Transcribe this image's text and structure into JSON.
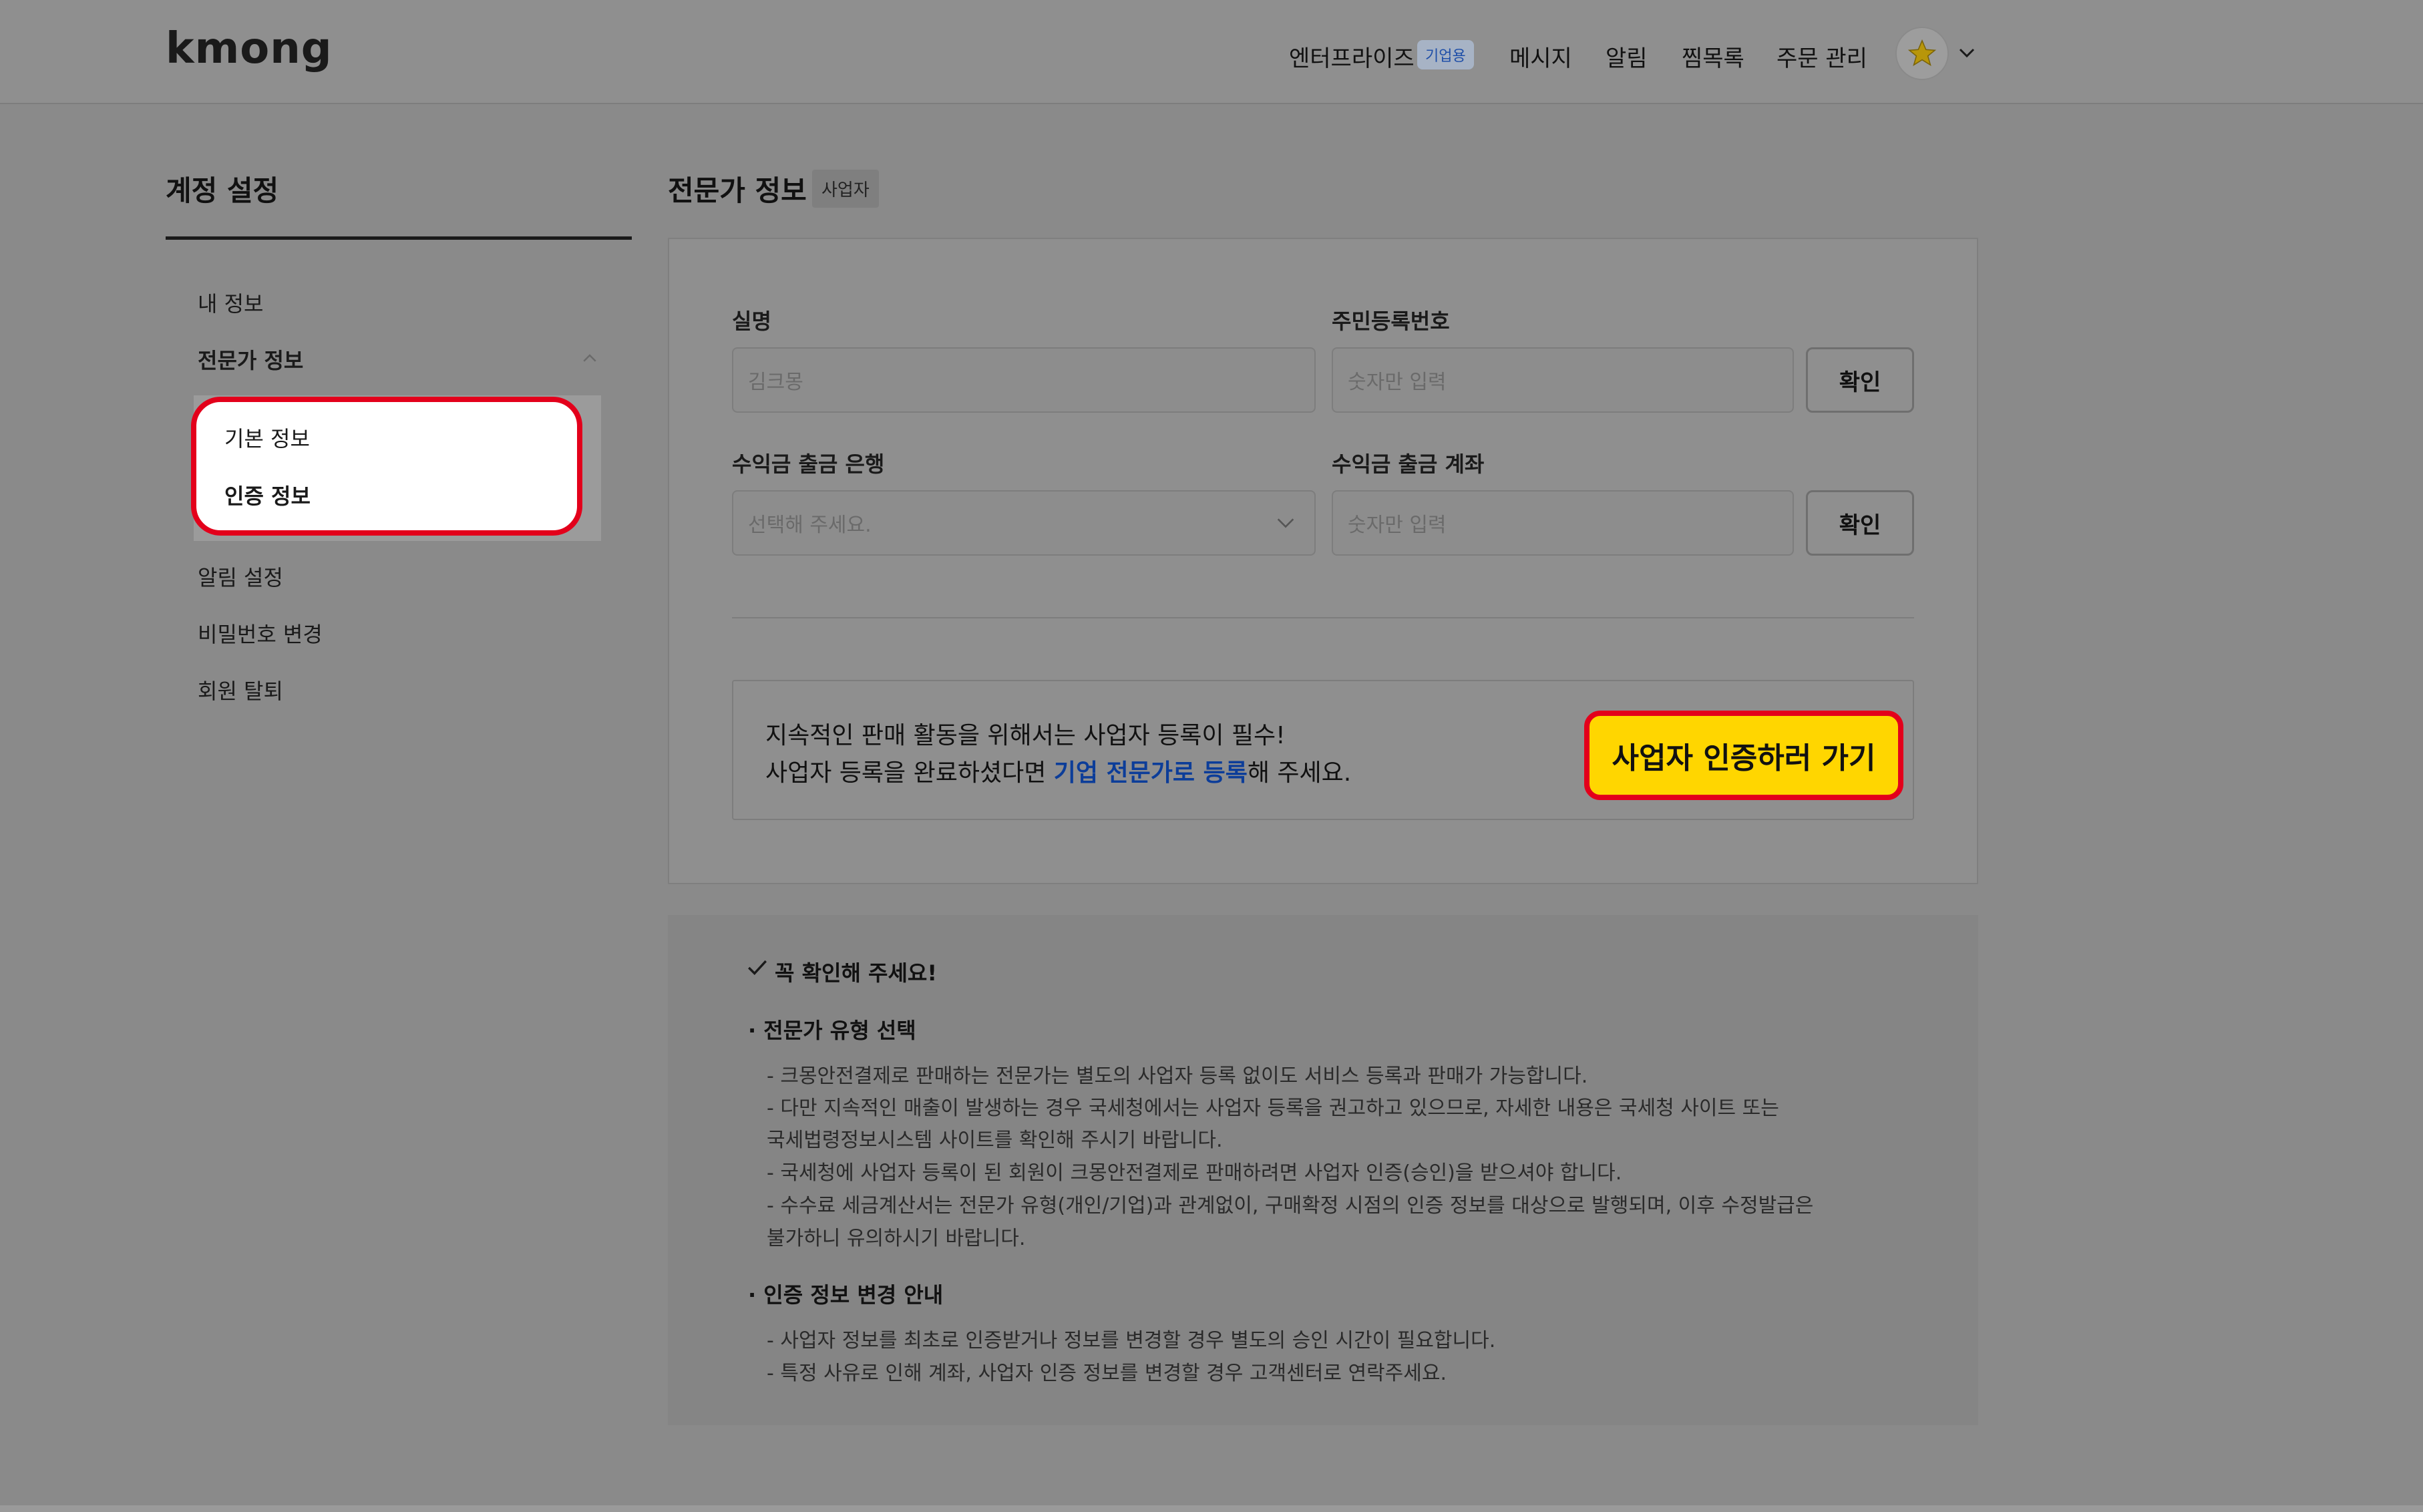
{
  "header": {
    "logo": "kmong",
    "nav": {
      "enterprise": "엔터프라이즈",
      "enterprise_badge": "기업용",
      "messages": "메시지",
      "notifications": "알림",
      "wishlist": "찜목록",
      "orders": "주문 관리"
    }
  },
  "sidebar": {
    "title": "계정 설정",
    "items": {
      "my_info": "내 정보",
      "expert_info": "전문가 정보",
      "basic_info": "기본 정보",
      "auth_info": "인증 정보",
      "notification_settings": "알림 설정",
      "change_password": "비밀번호 변경",
      "withdraw": "회원 탈퇴"
    }
  },
  "main": {
    "title": "전문가 정보",
    "badge": "사업자",
    "form": {
      "name_label": "실명",
      "name_value": "김크몽",
      "rrn_label": "주민등록번호",
      "rrn_placeholder": "숫자만 입력",
      "rrn_confirm": "확인",
      "bank_label": "수익금 출금 은행",
      "bank_placeholder": "선택해 주세요.",
      "account_label": "수익금 출금 계좌",
      "account_placeholder": "숫자만 입력",
      "account_confirm": "확인"
    },
    "notice": {
      "line1": "지속적인 판매 활동을 위해서는 사업자 등록이 필수!",
      "line2_prefix": "사업자 등록을 완료하셨다면 ",
      "line2_link": "기업 전문가로 등록",
      "line2_suffix": "해 주세요.",
      "cta": "사업자 인증하러 가기"
    }
  },
  "info": {
    "heading": "꼭 확인해 주세요!",
    "section1_title": "전문가 유형 선택",
    "section1_lines": [
      "- 크몽안전결제로 판매하는 전문가는 별도의 사업자 등록 없이도 서비스 등록과 판매가 가능합니다.",
      "- 다만 지속적인 매출이 발생하는 경우 국세청에서는 사업자 등록을 권고하고 있으므로, 자세한 내용은 국세청 사이트 또는",
      "국세법령정보시스템 사이트를 확인해 주시기 바랍니다.",
      "- 국세청에 사업자 등록이 된 회원이 크몽안전결제로 판매하려면 사업자 인증(승인)을 받으셔야 합니다.",
      "- 수수료 세금계산서는 전문가 유형(개인/기업)과 관계없이, 구매확정 시점의 인증 정보를 대상으로 발행되며, 이후 수정발급은",
      "불가하니 유의하시기 바랍니다."
    ],
    "section2_title": "인증 정보 변경 안내",
    "section2_lines": [
      "- 사업자 정보를 최초로 인증받거나 정보를 변경할 경우 별도의 승인 시간이 필요합니다.",
      "- 특정 사유로 인해 계좌, 사업자 인증 정보를 변경할 경우 고객센터로 연락주세요."
    ]
  },
  "colors": {
    "overlay_bg": "#8a8a8a",
    "highlight_red": "#e3001b",
    "cta_yellow": "#ffd600",
    "link_blue": "#0c3d99"
  },
  "icons": [
    "chevron-down-icon",
    "chevron-up-icon",
    "star-avatar-icon",
    "check-icon"
  ]
}
